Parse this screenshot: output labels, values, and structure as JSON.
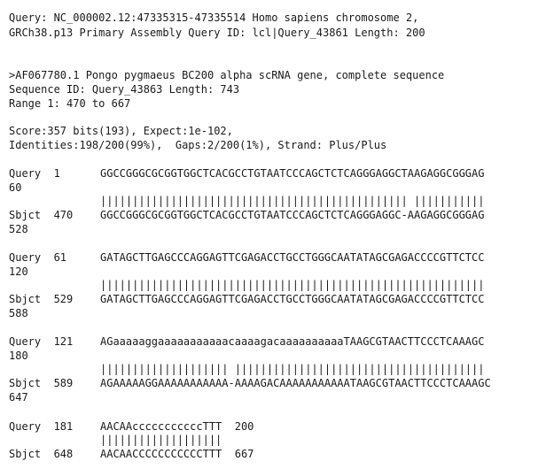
{
  "query_header": {
    "line1": "Query: NC_000002.12:47335315-47335514 Homo sapiens chromosome 2,",
    "line2": "GRCh38.p13 Primary Assembly Query ID: lcl|Query_43861 Length: 200"
  },
  "subject_header": {
    "title": ">AF067780.1 Pongo pygmaeus BC200 alpha scRNA gene, complete sequence",
    "sequence_id": "Sequence ID: Query_43863 Length: 743",
    "range": "Range 1: 470 to 667"
  },
  "stats": {
    "score_line": "Score:357 bits(193), Expect:1e-102,",
    "identities_line": "Identities:198/200(99%),  Gaps:2/200(1%), Strand: Plus/Plus"
  },
  "blocks": [
    {
      "query_prefix": "Query  1",
      "query_seq": "GGCCGGGCGCGGTGGCTCACGCCTGTAATCCCAGCTCTCAGGGAGGCTAAGAGGCGGGAG",
      "query_end": "60",
      "match": "|||||||||||||||||||||||||||||||||||||||||||||||| |||||||||||",
      "sbjct_prefix": "Sbjct  470",
      "sbjct_seq": "GGCCGGGCGCGGTGGCTCACGCCTGTAATCCCAGCTCTCAGGGAGGC-AAGAGGCGGGAG",
      "sbjct_end": "528"
    },
    {
      "query_prefix": "Query  61",
      "query_seq": "GATAGCTTGAGCCCAGGAGTTCGAGACCTGCCTGGGCAATATAGCGAGACCCCGTTCTCC",
      "query_end": "120",
      "match": "||||||||||||||||||||||||||||||||||||||||||||||||||||||||||||",
      "sbjct_prefix": "Sbjct  529",
      "sbjct_seq": "GATAGCTTGAGCCCAGGAGTTCGAGACCTGCCTGGGCAATATAGCGAGACCCCGTTCTCC",
      "sbjct_end": "588"
    },
    {
      "query_prefix": "Query  121",
      "query_seq": "AGaaaaaggaaaaaaaaaaacaaaagacaaaaaaaaaaTAAGCGTAACTTCCCTCAAAGC",
      "query_end": "180",
      "match": "|||||||||||||||||||| |||||||||||||||||||||||||||||||||||||||",
      "sbjct_prefix": "Sbjct  589",
      "sbjct_seq": "AGAAAAAGGAAAAAAAAAAA-AAAAGACAAAAAAAAAAATAAGCGTAACTTCCCTCAAAGC",
      "sbjct_end": "647"
    },
    {
      "query_prefix": "Query  181",
      "query_seq": "AACAAcccccccccccTTT  200",
      "query_end": "",
      "match": "|||||||||||||||||||",
      "sbjct_prefix": "Sbjct  648",
      "sbjct_seq": "AACAACCCCCCCCCCCTTT  667",
      "sbjct_end": ""
    }
  ]
}
